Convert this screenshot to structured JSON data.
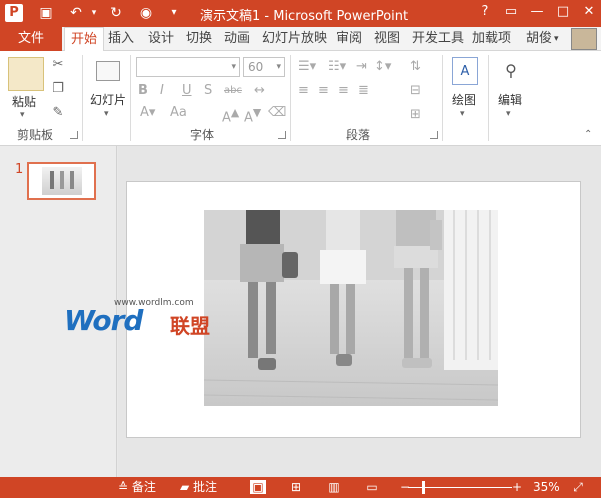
{
  "titlebar": {
    "title": "演示文稿1 - Microsoft PowerPoint",
    "app_logo": "P",
    "qat_icons": [
      "save-icon",
      "undo-icon",
      "redo-icon",
      "present-icon",
      "customize-icon"
    ],
    "window_buttons": [
      "?",
      "□",
      "—",
      "□",
      "✕"
    ]
  },
  "tabs": {
    "file": "文件",
    "items": [
      "开始",
      "插入",
      "设计",
      "切换",
      "动画",
      "幻灯片放映",
      "审阅",
      "视图",
      "开发工具",
      "加载项",
      "胡俊"
    ]
  },
  "ribbon": {
    "clipboard": {
      "paste": "粘贴",
      "label": "剪贴板"
    },
    "slides": {
      "new_slide": "幻灯片"
    },
    "font": {
      "font_name": "",
      "font_size": "60",
      "label": "字体",
      "bold": "B",
      "italic": "I",
      "underline": "U",
      "shadow": "S",
      "strike": "abc",
      "size_label": "Aa"
    },
    "paragraph": {
      "label": "段落"
    },
    "drawing": {
      "label": "绘图"
    },
    "editing": {
      "label": "编辑"
    }
  },
  "thumbnails": [
    {
      "number": "1"
    }
  ],
  "watermark": {
    "url": "www.wordlm.com",
    "word": "Word",
    "cn": "联盟"
  },
  "statusbar": {
    "notes": "备注",
    "comments": "批注",
    "zoom": "35%"
  },
  "colors": {
    "accent": "#d04525",
    "ribbon_bg": "#ffffff",
    "pane_bg": "#ececec"
  }
}
